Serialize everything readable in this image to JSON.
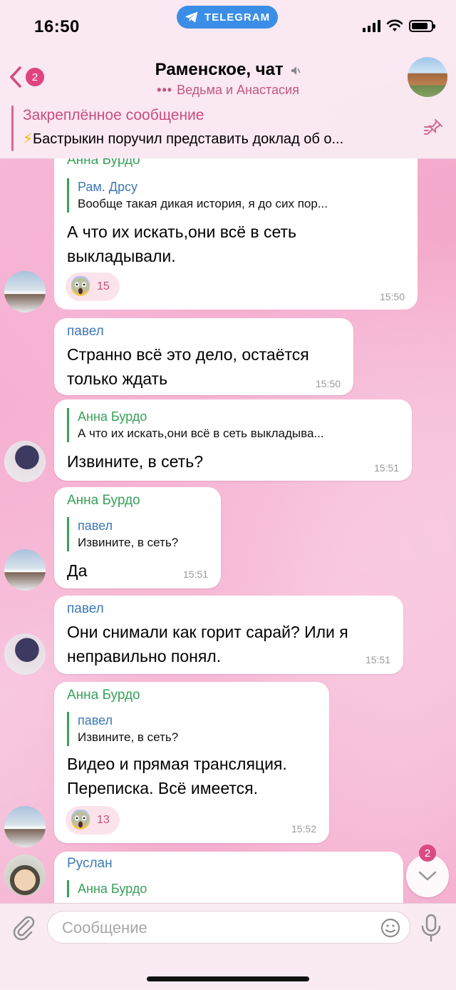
{
  "status": {
    "time": "16:50",
    "app_pill": "TELEGRAM"
  },
  "header": {
    "back_badge": "2",
    "title": "Раменское, чат",
    "subtitle_typing": "Ведьма и Анастасия",
    "pinned_title": "Закреплённое сообщение",
    "pinned_text": "Бастрыкин поручил представить доклад об о..."
  },
  "messages": [
    {
      "sender": "Анна Бурдо",
      "reply_name": "Рам. Дрсу",
      "reply_text": "Вообще такая дикая история, я до сих пор...",
      "line1": "А что их искать,они всё в сеть",
      "line2": "выкладывали.",
      "reaction_count": "15",
      "time": "15:50"
    },
    {
      "sender": "павел",
      "line1": "Странно всё это дело, остаётся",
      "line2": "только ждать",
      "time": "15:50"
    },
    {
      "reply_name": "Анна Бурдо",
      "reply_text": "А что их искать,они всё в сеть выкладыва...",
      "line1": "Извините, в сеть?",
      "time": "15:51"
    },
    {
      "sender": "Анна Бурдо",
      "reply_name": "павел",
      "reply_text": "Извините, в сеть?",
      "line1": "Да",
      "time": "15:51"
    },
    {
      "sender": "павел",
      "line1": "Они снимали как горит сарай? Или я",
      "line2": "неправильно понял.",
      "time": "15:51"
    },
    {
      "sender": "Анна Бурдо",
      "reply_name": "павел",
      "reply_text": "Извините, в сеть?",
      "line1": "Видео и прямая трансляция.",
      "line2": "Переписка. Всё имеется.",
      "reaction_count": "13",
      "time": "15:52"
    },
    {
      "sender": "Руслан",
      "reply_name": "Анна Бурдо"
    }
  ],
  "scroll_badge": "2",
  "composer": {
    "placeholder": "Сообщение"
  },
  "colors": {
    "accent_pink": "#c84e7d",
    "green_name": "#38a05a",
    "blue_name": "#3d79b6",
    "telegram_blue": "#3a8ee6"
  }
}
